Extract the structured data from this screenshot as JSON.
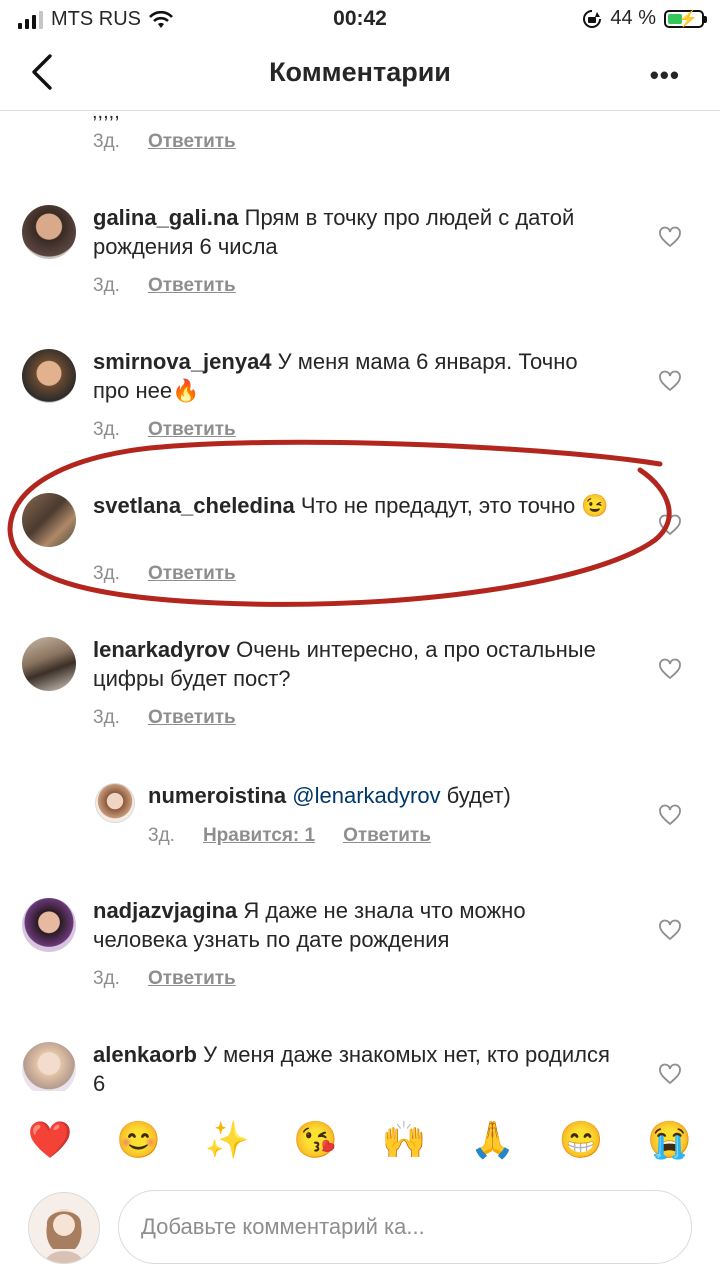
{
  "status_bar": {
    "carrier": "MTS RUS",
    "time": "00:42",
    "battery": "44 %",
    "battery_level": 0.44
  },
  "header": {
    "title": "Комментарии"
  },
  "top_fragment": {
    "text": ",,,,,",
    "time": "3д.",
    "reply": "Ответить"
  },
  "comments": [
    {
      "user": "galina_gali.na",
      "text": "Прям в точку про людей с датой рождения 6 числа",
      "time": "3д.",
      "reply": "Ответить"
    },
    {
      "user": "smirnova_jenya4",
      "text": "У меня мама 6 января. Точно про нее🔥",
      "time": "3д.",
      "reply": "Ответить"
    },
    {
      "user": "svetlana_cheledina",
      "text": "Что не предадут, это точно 😉",
      "time": "3д.",
      "reply": "Ответить"
    },
    {
      "user": "lenarkadyrov",
      "text": "Очень интересно, а про остальные цифры будет пост?",
      "time": "3д.",
      "reply": "Ответить"
    },
    {
      "user": "numeroistina",
      "mention": "@lenarkadyrov",
      "text": " будет)",
      "time": "3д.",
      "likes": "Нравится: 1",
      "reply": "Ответить"
    },
    {
      "user": "nadjazvjagina",
      "text": "Я даже не знала что можно человека узнать по дате рождения",
      "time": "3д.",
      "reply": "Ответить"
    },
    {
      "user": "alenkaorb",
      "text": "У меня даже знакомых нет, кто родился 6",
      "time": "",
      "reply": ""
    }
  ],
  "emoji_bar": [
    "❤️",
    "😊",
    "✨",
    "😘",
    "🙌",
    "🙏",
    "😁",
    "😭"
  ],
  "input": {
    "placeholder": "Добавьте комментарий ка..."
  },
  "colors": {
    "annotation": "#b3261e",
    "link": "#00376b",
    "meta": "#8e8e8e"
  }
}
